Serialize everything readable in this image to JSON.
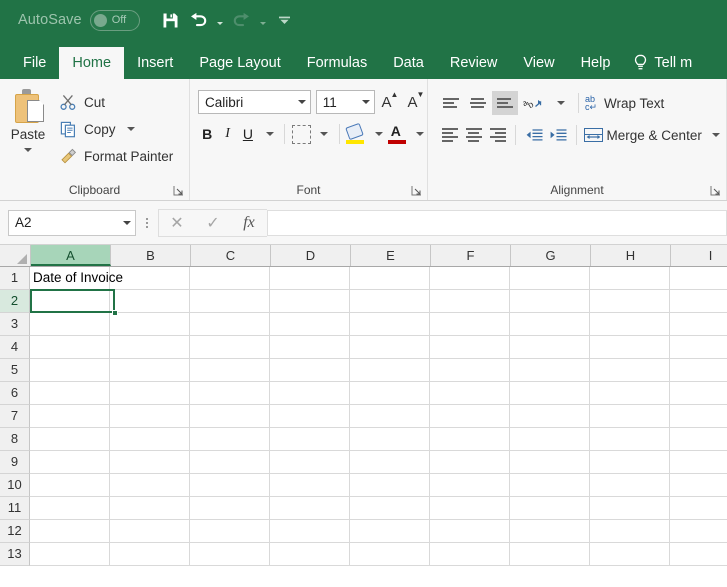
{
  "titlebar": {
    "autosave_label": "AutoSave",
    "autosave_state": "Off",
    "quick_access": [
      {
        "name": "save-button",
        "icon": "save-icon"
      },
      {
        "name": "undo-button",
        "icon": "undo-icon"
      },
      {
        "name": "redo-button",
        "icon": "redo-icon"
      },
      {
        "name": "customize-quick-access-toolbar-button",
        "icon": "chevron-down-icon"
      }
    ]
  },
  "tabs": [
    {
      "label": "File",
      "active": false
    },
    {
      "label": "Home",
      "active": true
    },
    {
      "label": "Insert",
      "active": false
    },
    {
      "label": "Page Layout",
      "active": false
    },
    {
      "label": "Formulas",
      "active": false
    },
    {
      "label": "Data",
      "active": false
    },
    {
      "label": "Review",
      "active": false
    },
    {
      "label": "View",
      "active": false
    },
    {
      "label": "Help",
      "active": false
    }
  ],
  "tell_me": "Tell m",
  "ribbon": {
    "clipboard": {
      "group_label": "Clipboard",
      "paste_label": "Paste",
      "cut_label": "Cut",
      "copy_label": "Copy",
      "format_painter_label": "Format Painter"
    },
    "font": {
      "group_label": "Font",
      "font_name": "Calibri",
      "font_size": "11",
      "bold_label": "B",
      "italic_label": "I",
      "underline_label": "U",
      "grow_font_label": "A",
      "shrink_font_label": "A",
      "fill_color": "#ffe600",
      "font_color": "#c00000"
    },
    "alignment": {
      "group_label": "Alignment",
      "wrap_text_label": "Wrap Text",
      "merge_center_label": "Merge & Center",
      "orientation_label": "ab"
    }
  },
  "formula_bar": {
    "name_box_value": "A2",
    "cancel_icon": "✕",
    "enter_icon": "✓",
    "function_icon": "fx",
    "formula_value": ""
  },
  "grid": {
    "columns": [
      "A",
      "B",
      "C",
      "D",
      "E",
      "F",
      "G",
      "H",
      "I"
    ],
    "selected_column": "A",
    "rows": [
      "1",
      "2",
      "3",
      "4",
      "5",
      "6",
      "7",
      "8",
      "9",
      "10",
      "11",
      "12",
      "13"
    ],
    "selected_row": "2",
    "cells": {
      "A1": "Date of Invoice"
    },
    "active_cell": "A2"
  },
  "colors": {
    "excel_green": "#217346",
    "ribbon_bg": "#f7f7f7",
    "header_bg": "#f0f0f0",
    "gridline": "#d9d9d9"
  }
}
